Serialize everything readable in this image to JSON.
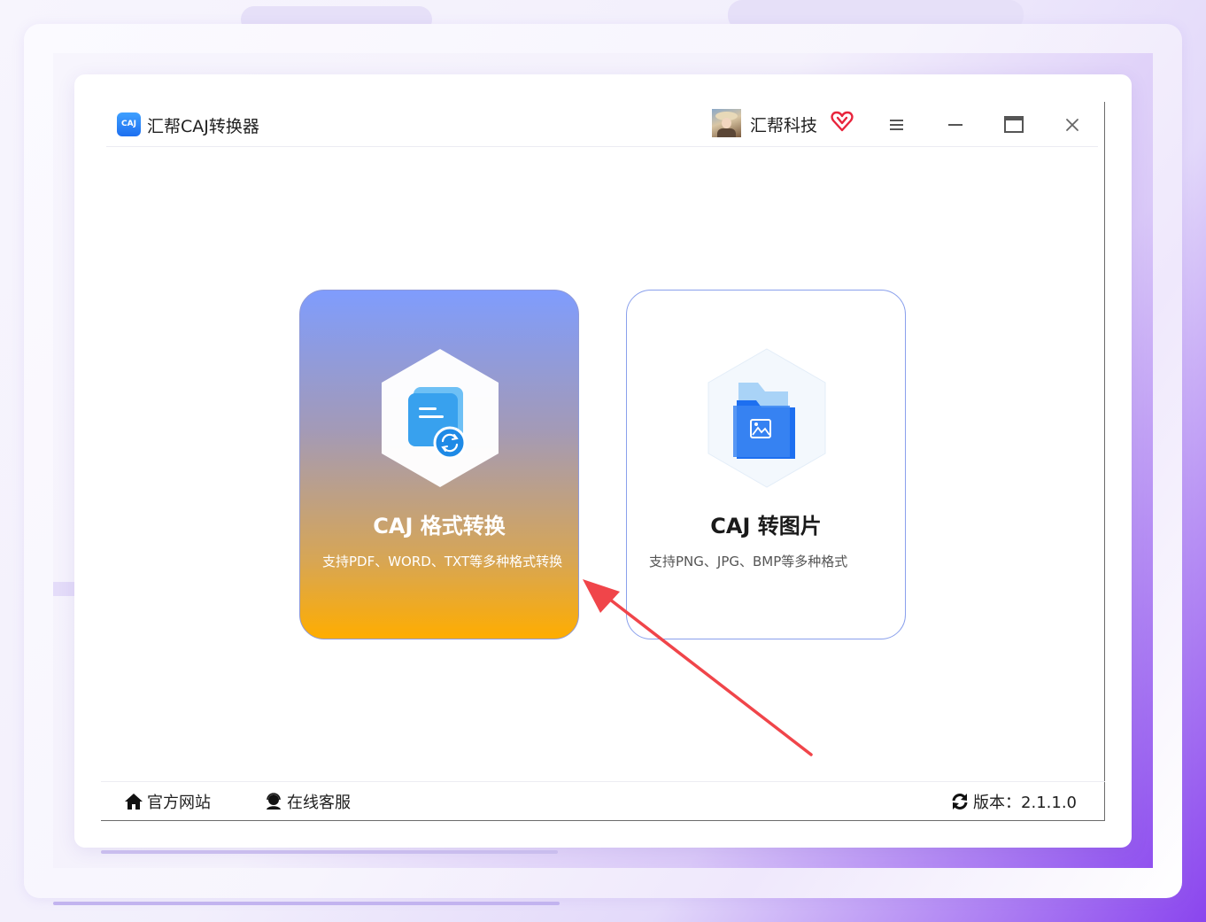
{
  "app": {
    "title": "汇帮CAJ转换器",
    "logo_text": "CAJ",
    "logo_icon": "caj-app-logo"
  },
  "user": {
    "name": "汇帮科技",
    "vip_icon": "heart-vip-icon"
  },
  "window_controls": [
    "menu-icon",
    "minimize-icon",
    "maximize-icon",
    "close-icon"
  ],
  "cards": [
    {
      "title": "CAJ 格式转换",
      "description": "支持PDF、WORD、TXT等多种格式转换",
      "icon": "document-convert-icon"
    },
    {
      "title": "CAJ 转图片",
      "description": "支持PNG、JPG、BMP等多种格式",
      "icon": "image-folder-icon"
    }
  ],
  "footer": {
    "official_site": "官方网站",
    "online_service": "在线客服",
    "version_label": "版本：2.1.1.0"
  },
  "colors": {
    "accent_blue": "#1d6ff0",
    "card_gradient_top": "#7f9cfd",
    "card_gradient_bottom": "#ffad00",
    "card_border": "#8aa0ec",
    "annotation_arrow": "#f0454a",
    "vip_red": "#e8243c"
  }
}
